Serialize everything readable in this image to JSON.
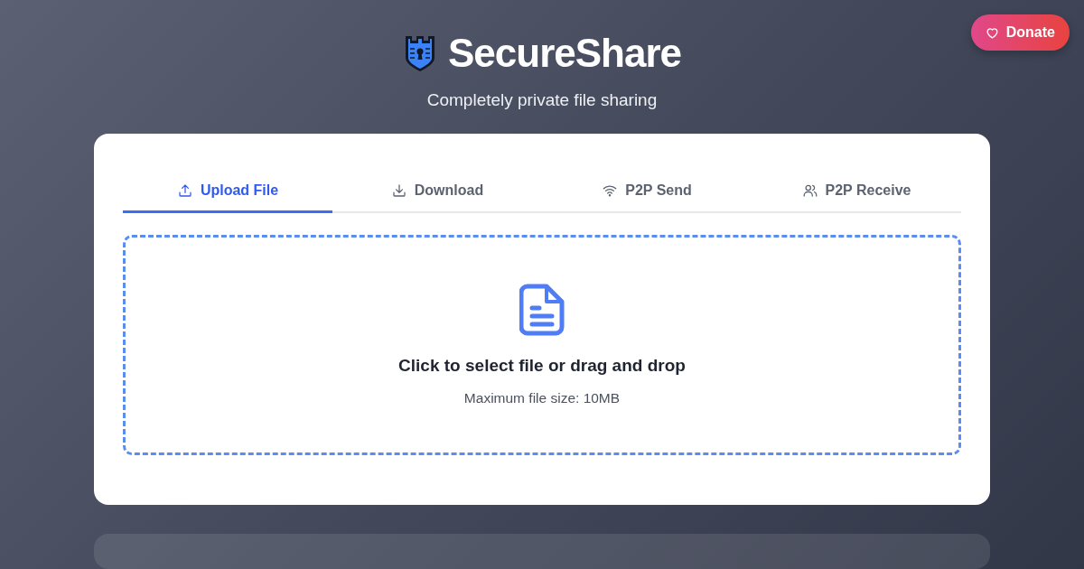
{
  "donate": {
    "label": "Donate"
  },
  "header": {
    "title": "SecureShare",
    "subtitle": "Completely private file sharing"
  },
  "tabs": [
    {
      "label": "Upload File",
      "kind": "upload",
      "selected": true
    },
    {
      "label": "Download",
      "kind": "download",
      "selected": false
    },
    {
      "label": "P2P Send",
      "kind": "wifi",
      "selected": false
    },
    {
      "label": "P2P Receive",
      "kind": "users",
      "selected": false
    }
  ],
  "dropzone": {
    "title": "Click to select file or drag and drop",
    "hint": "Maximum file size: 10MB"
  }
}
